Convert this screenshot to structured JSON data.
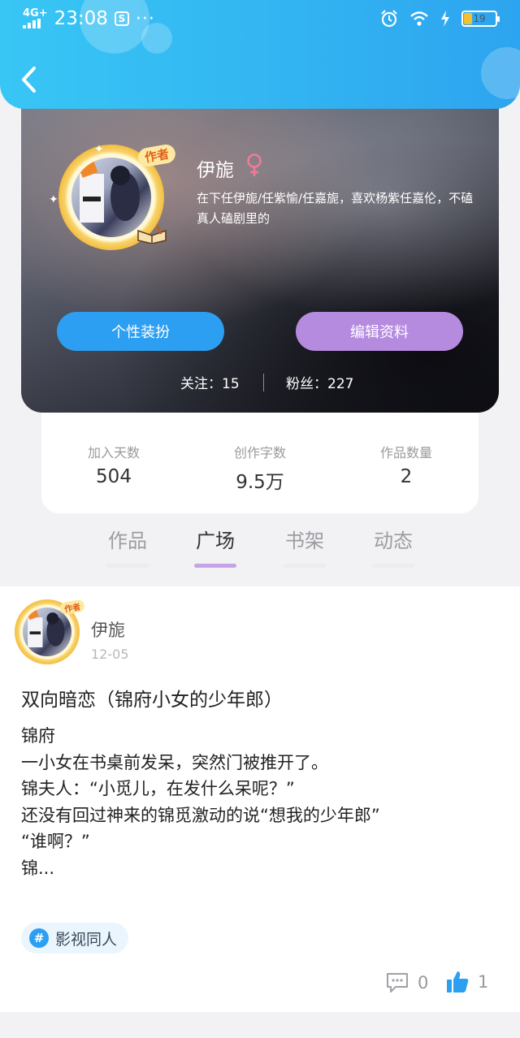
{
  "status_bar": {
    "network": "4G",
    "network_plus": "+",
    "time": "23:08",
    "s_badge": "S",
    "dots": "···",
    "battery": "19"
  },
  "profile": {
    "name": "伊旎",
    "badge": "作者",
    "bio": "在下任伊旎/任紫愉/任嘉旎，喜欢杨紫任嘉伦，不磕真人磕剧里的",
    "buttons": {
      "style": "个性装扮",
      "edit": "编辑资料"
    },
    "following": "关注：15",
    "fans": "粉丝：227"
  },
  "stats": [
    {
      "label": "加入天数",
      "value": "504"
    },
    {
      "label": "创作字数",
      "value": "9.5万"
    },
    {
      "label": "作品数量",
      "value": "2"
    }
  ],
  "tabs": [
    {
      "label": "作品"
    },
    {
      "label": "广场"
    },
    {
      "label": "书架"
    },
    {
      "label": "动态"
    }
  ],
  "active_tab": "广场",
  "post": {
    "author": "伊旎",
    "badge": "作者",
    "date": "12-05",
    "title": "双向暗恋（锦府小女的少年郎）",
    "lines": [
      "锦府",
      "一小女在书桌前发呆，突然门被推开了。",
      "锦夫人：“小觅儿，在发什么呆呢？”",
      "还没有回过神来的锦觅激动的说“想我的少年郎”",
      "“谁啊？”",
      "锦..."
    ],
    "tag": "影视同人",
    "comments": "0",
    "likes": "1"
  },
  "colors": {
    "header": "#33b6f2",
    "accent_blue": "#2d9ff2",
    "accent_purple": "#b58be0",
    "tab_active_underline": "#c6a3e6",
    "female": "#f07a9a"
  },
  "icons": [
    "back-icon",
    "female-icon",
    "hash-icon",
    "comment-icon",
    "thumbs-up-icon",
    "alarm-icon",
    "wifi-icon",
    "charging-icon",
    "battery-icon",
    "signal-icon"
  ]
}
